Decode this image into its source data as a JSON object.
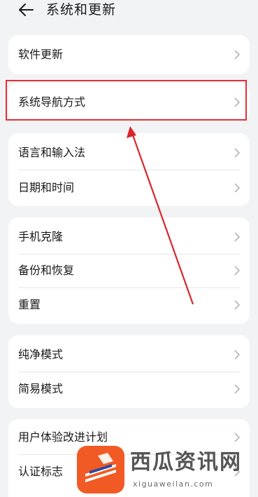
{
  "header": {
    "title": "系统和更新",
    "back_icon": "arrow-left-icon"
  },
  "groups": [
    {
      "items": [
        {
          "label": "软件更新"
        }
      ]
    },
    {
      "items": [
        {
          "label": "系统导航方式"
        }
      ]
    },
    {
      "items": [
        {
          "label": "语言和输入法"
        },
        {
          "label": "日期和时间"
        }
      ]
    },
    {
      "items": [
        {
          "label": "手机克隆"
        },
        {
          "label": "备份和恢复"
        },
        {
          "label": "重置"
        }
      ]
    },
    {
      "items": [
        {
          "label": "纯净模式"
        },
        {
          "label": "简易模式"
        }
      ]
    },
    {
      "items": [
        {
          "label": "用户体验改进计划"
        },
        {
          "label": "认证标志"
        }
      ]
    }
  ],
  "annotation": {
    "color": "#e03035"
  },
  "watermark": {
    "text": "西瓜资讯网",
    "url": "xiguaweilan.com",
    "brand_color": "#f15a24"
  }
}
